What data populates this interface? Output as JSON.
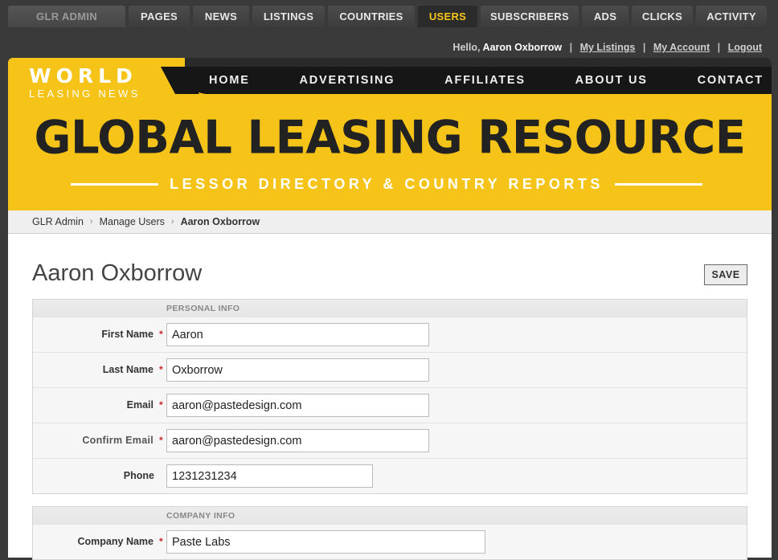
{
  "admin_tabs": [
    {
      "label": "GLR ADMIN",
      "active": false
    },
    {
      "label": "PAGES",
      "active": false
    },
    {
      "label": "NEWS",
      "active": false
    },
    {
      "label": "LISTINGS",
      "active": false
    },
    {
      "label": "COUNTRIES",
      "active": false
    },
    {
      "label": "USERS",
      "active": true
    },
    {
      "label": "SUBSCRIBERS",
      "active": false
    },
    {
      "label": "ADS",
      "active": false
    },
    {
      "label": "CLICKS",
      "active": false
    },
    {
      "label": "ACTIVITY",
      "active": false
    }
  ],
  "greeting": {
    "hello": "Hello,",
    "user_name": "Aaron Oxborrow",
    "links": [
      "My Listings",
      "My Account",
      "Logout"
    ],
    "separator": "|"
  },
  "logo": {
    "word": "WORLD",
    "sub": "LEASING NEWS"
  },
  "nav": [
    "HOME",
    "ADVERTISING",
    "AFFILIATES",
    "ABOUT US",
    "CONTACT"
  ],
  "hero": {
    "title": "GLOBAL LEASING RESOURCE",
    "subtitle": "LESSOR DIRECTORY & COUNTRY REPORTS"
  },
  "breadcrumb": [
    "GLR Admin",
    "Manage Users",
    "Aaron Oxborrow"
  ],
  "page_title": "Aaron Oxborrow",
  "save_label": "SAVE",
  "personal_info": {
    "heading": "PERSONAL INFO",
    "fields": [
      {
        "label": "First Name",
        "value": "Aaron",
        "required": true
      },
      {
        "label": "Last Name",
        "value": "Oxborrow",
        "required": true
      },
      {
        "label": "Email",
        "value": "aaron@pastedesign.com",
        "required": true
      },
      {
        "label": "Confirm Email",
        "value": "aaron@pastedesign.com",
        "required": true
      },
      {
        "label": "Phone",
        "value": "1231231234",
        "required": false
      }
    ]
  },
  "company_info": {
    "heading": "COMPANY INFO",
    "fields": [
      {
        "label": "Company Name",
        "value": "Paste Labs",
        "required": true
      }
    ]
  },
  "required_mark": "*",
  "colors": {
    "brand_yellow": "#f6c418",
    "active_tab": "#f5c518",
    "required": "#d0262b"
  }
}
